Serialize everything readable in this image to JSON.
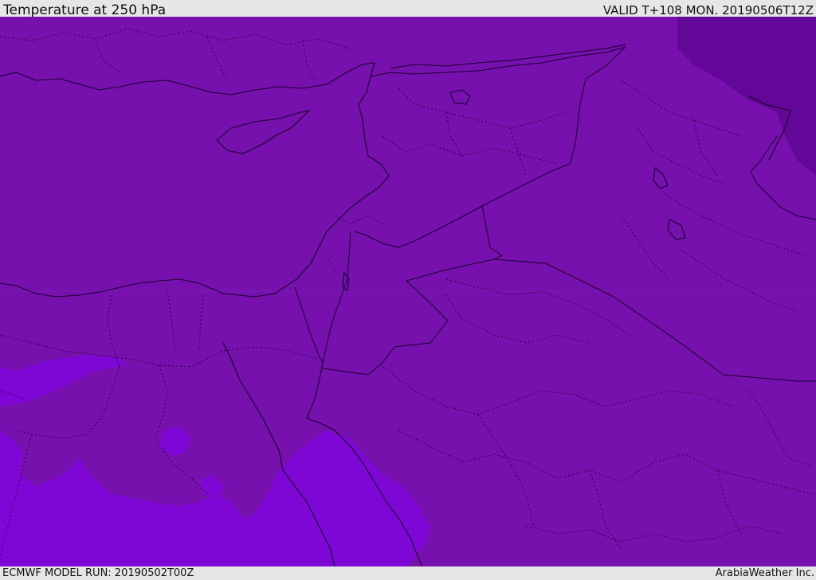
{
  "header": {
    "title": "Temperature at 250 hPa",
    "valid_time": "VALID T+108 MON. 20190506T12Z"
  },
  "footer": {
    "model_run": "ECMWF MODEL RUN: 20190502T00Z",
    "credit": "ArabiaWeather Inc."
  },
  "map": {
    "field": "Temperature at 250 hPa",
    "colors": {
      "base": "#7611ae",
      "warm_band": "#7e07d6",
      "cold_pocket": "#620797",
      "boundary_line": "#1a0030"
    }
  }
}
